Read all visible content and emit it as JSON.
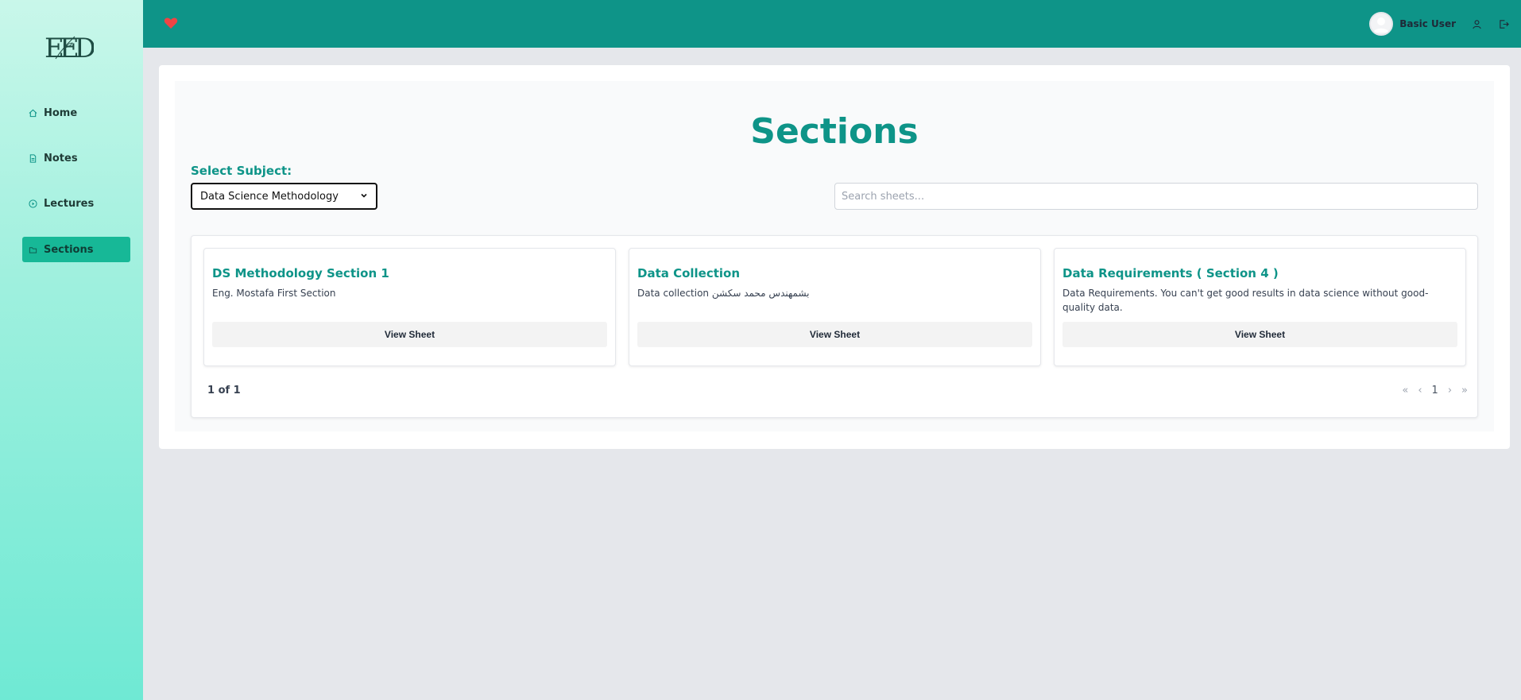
{
  "sidebar": {
    "logo": "EED",
    "items": [
      {
        "label": "Home",
        "icon": "home-icon"
      },
      {
        "label": "Notes",
        "icon": "document-icon"
      },
      {
        "label": "Lectures",
        "icon": "play-circle-icon"
      },
      {
        "label": "Sections",
        "icon": "folder-icon",
        "active": true
      }
    ]
  },
  "header": {
    "heart_icon": "heart-icon",
    "user_name": "Basic User",
    "profile_icon": "user-icon",
    "logout_icon": "logout-icon"
  },
  "main": {
    "title": "Sections",
    "subject_label": "Select Subject:",
    "subject_selected": "Data Science Methodology",
    "search_placeholder": "Search sheets...",
    "cards": [
      {
        "title": "DS Methodology Section 1",
        "description": "Eng. Mostafa First Section",
        "button": "View Sheet"
      },
      {
        "title": "Data Collection",
        "description": "Data collection بشمهندس محمد سكشن",
        "button": "View Sheet"
      },
      {
        "title": "Data Requirements ( Section 4 )",
        "description": "Data Requirements. You can't get good results in data science without good-quality data.",
        "button": "View Sheet"
      }
    ],
    "pagination": {
      "info": "1 of 1",
      "first": "«",
      "prev": "‹",
      "current": "1",
      "next": "›",
      "last": "»"
    }
  },
  "colors": {
    "accent": "#0e9488",
    "active_nav": "#17b897",
    "heart": "#ef4444"
  }
}
